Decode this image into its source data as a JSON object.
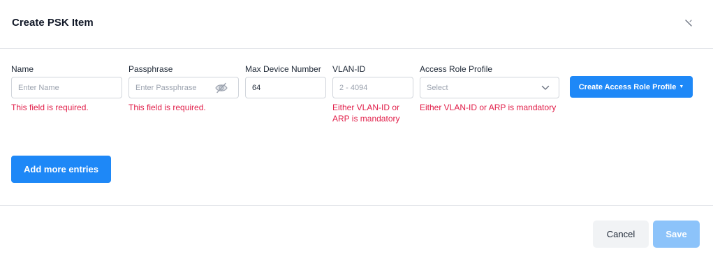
{
  "dialog": {
    "title": "Create PSK Item",
    "close_icon": "close-icon"
  },
  "fields": {
    "name": {
      "label": "Name",
      "placeholder": "Enter Name",
      "value": "",
      "error": "This field is required."
    },
    "passphrase": {
      "label": "Passphrase",
      "placeholder": "Enter Passphrase",
      "value": "",
      "error": "This field is required.",
      "icon": "eye-off-icon"
    },
    "max_device": {
      "label": "Max Device Number",
      "value": "64"
    },
    "vlan_id": {
      "label": "VLAN-ID",
      "placeholder": "2 - 4094",
      "value": "",
      "error": "Either VLAN-ID or ARP is mandatory"
    },
    "access_role": {
      "label": "Access Role Profile",
      "selected": "Select",
      "error": "Either VLAN-ID or ARP is mandatory",
      "icon": "chevron-down-icon"
    }
  },
  "buttons": {
    "create_role": "Create Access Role Profile",
    "add_more": "Add more entries",
    "cancel": "Cancel",
    "save": "Save"
  },
  "colors": {
    "primary": "#1e88f7",
    "primary_disabled": "#8cc3fa",
    "error": "#e11d48",
    "border": "#d1d5db"
  }
}
